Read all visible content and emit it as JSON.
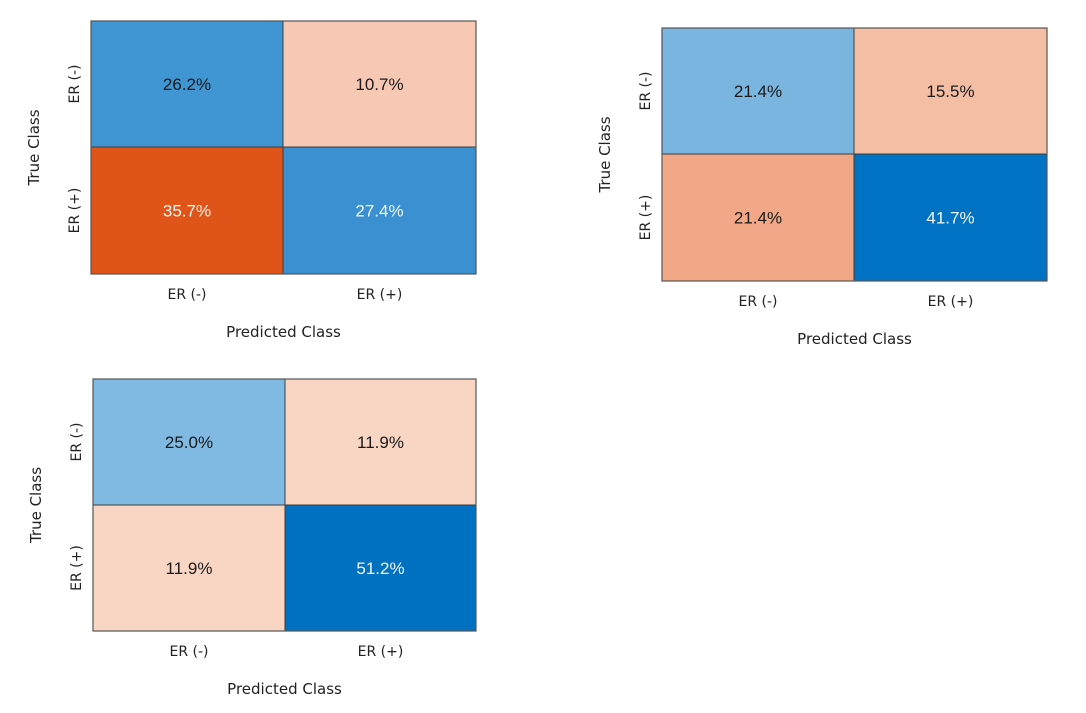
{
  "chart_data": [
    {
      "type": "heatmap",
      "subtype": "confusion-matrix",
      "position": "top-left",
      "xlabel": "Predicted Class",
      "ylabel": "True Class",
      "x_tick_labels": [
        "ER (-)",
        "ER (+)"
      ],
      "y_tick_labels": [
        "ER (-)",
        "ER (+)"
      ],
      "cells": [
        [
          {
            "value": 26.2,
            "label": "26.2%",
            "color": "#4096d2",
            "text_color": "#1a1a1a"
          },
          {
            "value": 10.7,
            "label": "10.7%",
            "color": "#f7c9b4",
            "text_color": "#1a1a1a"
          }
        ],
        [
          {
            "value": 35.7,
            "label": "35.7%",
            "color": "#df5519",
            "text_color": "#f5f5f5"
          },
          {
            "value": 27.4,
            "label": "27.4%",
            "color": "#3a90d0",
            "text_color": "#f5f5f5"
          }
        ]
      ]
    },
    {
      "type": "heatmap",
      "subtype": "confusion-matrix",
      "position": "top-right",
      "xlabel": "Predicted Class",
      "ylabel": "True Class",
      "x_tick_labels": [
        "ER (-)",
        "ER (+)"
      ],
      "y_tick_labels": [
        "ER (-)",
        "ER (+)"
      ],
      "cells": [
        [
          {
            "value": 21.4,
            "label": "21.4%",
            "color": "#79b5df",
            "text_color": "#1a1a1a"
          },
          {
            "value": 15.5,
            "label": "15.5%",
            "color": "#f4bea5",
            "text_color": "#1a1a1a"
          }
        ],
        [
          {
            "value": 21.4,
            "label": "21.4%",
            "color": "#f2a787",
            "text_color": "#1a1a1a"
          },
          {
            "value": 41.7,
            "label": "41.7%",
            "color": "#0072c4",
            "text_color": "#f5f5f5"
          }
        ]
      ]
    },
    {
      "type": "heatmap",
      "subtype": "confusion-matrix",
      "position": "bottom-left",
      "xlabel": "Predicted Class",
      "ylabel": "True Class",
      "x_tick_labels": [
        "ER (-)",
        "ER (+)"
      ],
      "y_tick_labels": [
        "ER (-)",
        "ER (+)"
      ],
      "cells": [
        [
          {
            "value": 25.0,
            "label": "25.0%",
            "color": "#80b9e1",
            "text_color": "#1a1a1a"
          },
          {
            "value": 11.9,
            "label": "11.9%",
            "color": "#f9d5c4",
            "text_color": "#1a1a1a"
          }
        ],
        [
          {
            "value": 11.9,
            "label": "11.9%",
            "color": "#f9d5c4",
            "text_color": "#1a1a1a"
          },
          {
            "value": 51.2,
            "label": "51.2%",
            "color": "#0070c0",
            "text_color": "#f5f5f5"
          }
        ]
      ]
    }
  ]
}
